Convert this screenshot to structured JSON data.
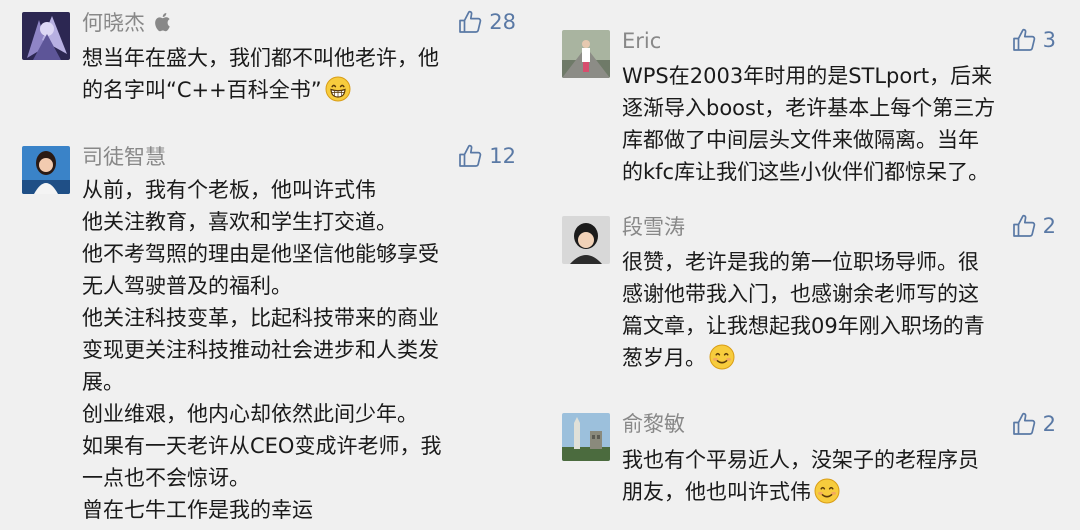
{
  "left_column": [
    {
      "author": "何晓杰",
      "likes": "28",
      "lines": [
        "想当年在盛大，我们都不叫他老许，他",
        "的名字叫“C++百科全书”"
      ]
    },
    {
      "author": "司徒智慧",
      "likes": "12",
      "lines": [
        "从前，我有个老板，他叫许式伟",
        "他关注教育，喜欢和学生打交道。",
        "他不考驾照的理由是他坚信他能够享受",
        "无人驾驶普及的福利。",
        "他关注科技变革，比起科技带来的商业",
        "变现更关注科技推动社会进步和人类发",
        "展。",
        "创业维艰，他内心却依然此间少年。",
        "如果有一天老许从CEO变成许老师，我",
        "一点也不会惊讶。",
        "曾在七牛工作是我的幸运"
      ]
    }
  ],
  "right_column": [
    {
      "author": "Eric",
      "likes": "3",
      "lines": [
        "WPS在2003年时用的是STLport，后来",
        "逐渐导入boost，老许基本上每个第三方",
        "库都做了中间层头文件来做隔离。当年",
        "的kfc库让我们这些小伙伴们都惊呆了。"
      ]
    },
    {
      "author": "段雪涛",
      "likes": "2",
      "lines": [
        "很赞，老许是我的第一位职场导师。很",
        "感谢他带我入门，也感谢余老师写的这",
        "篇文章，让我想起我09年刚入职场的青",
        "葱岁月。"
      ]
    },
    {
      "author": "俞黎敏",
      "likes": "2",
      "lines": [
        "我也有个平易近人，没架子的老程序员",
        "朋友，他也叫许式伟"
      ]
    }
  ],
  "colors": {
    "background": "#f0f0f0",
    "name": "#888888",
    "text": "#1a1a1a",
    "like": "#5a79a5"
  },
  "icons": {
    "like": "thumbs-up-icon",
    "device": "apple-logo-icon",
    "emoji_grin": "grinning-emoji-icon",
    "emoji_smile": "smiling-emoji-icon"
  }
}
